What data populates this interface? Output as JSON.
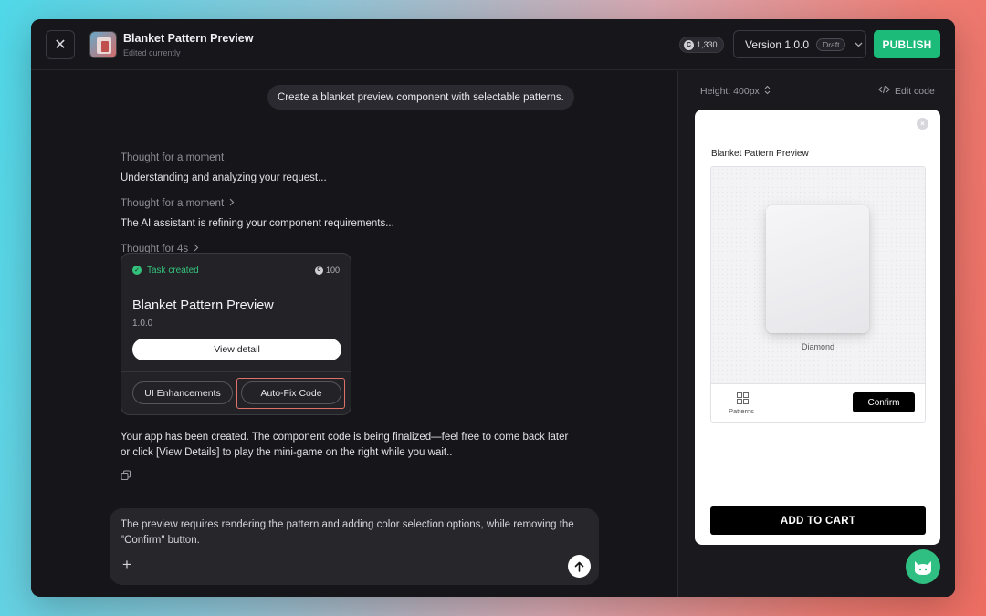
{
  "header": {
    "app_title": "Blanket Pattern Preview",
    "app_subtitle": "Edited currently",
    "credits": "1,330",
    "version": "Version 1.0.0",
    "version_badge": "Draft",
    "publish_label": "PUBLISH"
  },
  "chat": {
    "user_prompt": "Create a blanket preview component with selectable patterns.",
    "thoughts": [
      {
        "label": "Thought for a moment",
        "detail": "Understanding and analyzing your request..."
      },
      {
        "label": "Thought for a moment",
        "detail": "The AI assistant is refining your component requirements..."
      },
      {
        "label": "Thought for 4s"
      }
    ],
    "task": {
      "status": "Task created",
      "cost": "100",
      "title": "Blanket Pattern Preview",
      "version": "1.0.0",
      "view_label": "View detail",
      "action_1": "UI Enhancements",
      "action_2": "Auto-Fix Code"
    },
    "reply": "Your app has been created. The component code is being finalized—feel free to come back later or click [View Details] to play the mini-game on the right while you wait..",
    "composer_text": "The preview requires rendering the pattern and adding color selection options, while removing the \"Confirm\" button."
  },
  "panel": {
    "height_label": "Height: 400px",
    "edit_label": "Edit code",
    "preview": {
      "title": "Blanket Pattern Preview",
      "pattern_name": "Diamond",
      "patterns_tab": "Patterns",
      "confirm_label": "Confirm",
      "cart_label": "ADD TO CART"
    }
  },
  "colors": {
    "accent_green": "#1dbb7a",
    "highlight_red": "#e0706a",
    "window_bg": "#16161a"
  }
}
